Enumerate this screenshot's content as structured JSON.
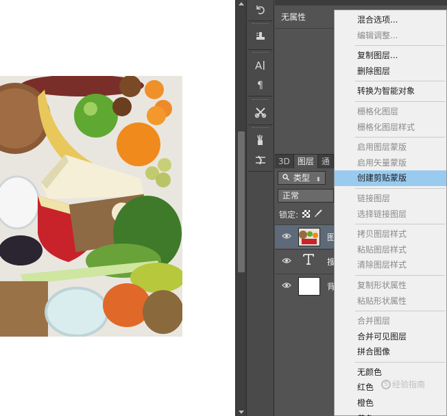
{
  "properties_panel": {
    "title": "无属性"
  },
  "layers_panel": {
    "tabs": [
      "3D",
      "图层",
      "通"
    ],
    "filter": {
      "label": "类型",
      "icon": "search-icon"
    },
    "blend_mode": "正常",
    "lock_label": "锁定:",
    "layers": [
      {
        "name": "图",
        "type": "image",
        "selected": true
      },
      {
        "name": "搜",
        "type": "text",
        "selected": false
      },
      {
        "name": "背",
        "type": "background",
        "selected": false
      }
    ]
  },
  "context_menu": {
    "groups": [
      [
        {
          "label": "混合选项...",
          "enabled": true
        },
        {
          "label": "编辑调整...",
          "enabled": false
        }
      ],
      [
        {
          "label": "复制图层...",
          "enabled": true
        },
        {
          "label": "删除图层",
          "enabled": true
        }
      ],
      [
        {
          "label": "转换为智能对象",
          "enabled": true
        }
      ],
      [
        {
          "label": "栅格化图层",
          "enabled": false
        },
        {
          "label": "栅格化图层样式",
          "enabled": false
        }
      ],
      [
        {
          "label": "启用图层蒙版",
          "enabled": false
        },
        {
          "label": "启用矢量蒙版",
          "enabled": false
        },
        {
          "label": "创建剪贴蒙版",
          "enabled": true,
          "highlighted": true
        }
      ],
      [
        {
          "label": "链接图层",
          "enabled": false
        },
        {
          "label": "选择链接图层",
          "enabled": false
        }
      ],
      [
        {
          "label": "拷贝图层样式",
          "enabled": false
        },
        {
          "label": "粘贴图层样式",
          "enabled": false
        },
        {
          "label": "清除图层样式",
          "enabled": false
        }
      ],
      [
        {
          "label": "复制形状属性",
          "enabled": false
        },
        {
          "label": "粘贴形状属性",
          "enabled": false
        }
      ],
      [
        {
          "label": "合并图层",
          "enabled": false
        },
        {
          "label": "合并可见图层",
          "enabled": true
        },
        {
          "label": "拼合图像",
          "enabled": true
        }
      ],
      [
        {
          "label": "无颜色",
          "enabled": true
        },
        {
          "label": "红色",
          "enabled": true
        },
        {
          "label": "橙色",
          "enabled": true
        },
        {
          "label": "黄色",
          "enabled": true
        }
      ]
    ]
  },
  "watermark": "经验指南",
  "colors": {
    "panel_bg": "#535353",
    "menu_bg": "#f0f0f0",
    "menu_highlight": "#99cbef",
    "selected_layer": "#5f6a78"
  }
}
